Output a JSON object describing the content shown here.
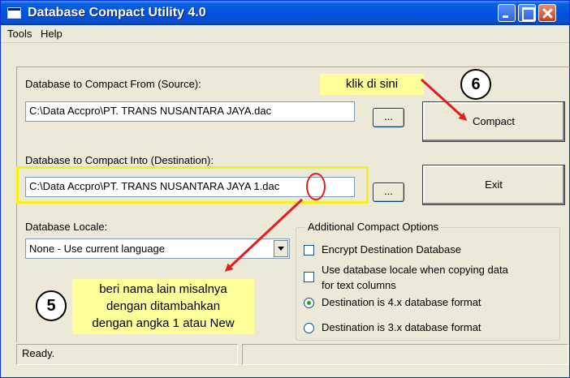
{
  "window": {
    "title": "Database Compact Utility 4.0"
  },
  "menu": {
    "tools": "Tools",
    "help": "Help"
  },
  "source": {
    "label": "Database to Compact From (Source):",
    "value": "C:\\Data Accpro\\PT. TRANS NUSANTARA JAYA.dac",
    "browse": "..."
  },
  "destination": {
    "label": "Database to Compact Into (Destination):",
    "value": "C:\\Data Accpro\\PT. TRANS NUSANTARA JAYA 1.dac",
    "browse": "..."
  },
  "buttons": {
    "compact": "Compact",
    "exit": "Exit"
  },
  "locale": {
    "label": "Database Locale:",
    "value": "None - Use current language"
  },
  "options": {
    "title": "Additional Compact Options",
    "encrypt": "Encrypt Destination Database",
    "use_locale_line1": "Use database locale when copying data",
    "use_locale_line2": "for text columns",
    "format4": "Destination is 4.x database format",
    "format3": "Destination is 3.x database format"
  },
  "status": {
    "text": "Ready."
  },
  "annotations": {
    "click_here": "klik di sini",
    "step6": "6",
    "step5": "5",
    "rename_line1": "beri nama lain misalnya",
    "rename_line2": "dengan ditambahkan",
    "rename_line3": "dengan angka 1 atau New"
  },
  "colors": {
    "titlebar": "#0053e1",
    "callout": "#ffff99",
    "highlight": "#f5ef1b",
    "arrow": "#e31c1c"
  }
}
